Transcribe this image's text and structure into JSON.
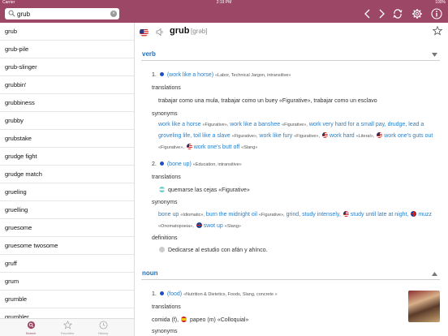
{
  "status_bar": {
    "carrier": "Carrier",
    "time": "2:19 PM",
    "battery": "100%"
  },
  "search": {
    "value": "grub"
  },
  "icons": {
    "search": "magnifier-icon",
    "clear": "clear-icon",
    "back": "chevron-left-icon",
    "forward": "chevron-right-icon",
    "refresh": "refresh-icon",
    "settings": "gear-icon",
    "info": "info-icon"
  },
  "word_list": [
    "grub",
    "grub-pile",
    "grub-slinger",
    "grubbin'",
    "grubbiness",
    "grubby",
    "grubstake",
    "grudge fight",
    "grudge match",
    "grueling",
    "gruelling",
    "gruesome",
    "gruesome twosome",
    "gruff",
    "grum",
    "grumble",
    "grumbler"
  ],
  "tabs": [
    {
      "label": "Search",
      "icon": "search-tab-icon"
    },
    {
      "label": "Favorites",
      "icon": "star-icon"
    },
    {
      "label": "History",
      "icon": "clock-icon"
    }
  ],
  "entry": {
    "headword": "grub",
    "ipa": "[grəb]",
    "sections": {
      "verb": "verb",
      "noun": "noun"
    },
    "labels": {
      "translations": "translations",
      "synonyms": "synonyms",
      "definitions": "definitions"
    },
    "sense1": {
      "num": "1.",
      "gloss": "(work like a horse)",
      "tags": "«Labor, Technical Jargon, intransitive»",
      "translation": "trabajar como una mula, trabajar como un buey «Figurative», trabajar como un esclavo",
      "syn": [
        {
          "w": "work like a horse",
          "t": "«Figurative»,"
        },
        {
          "w": "work like a banshee",
          "t": "«Figurative»,"
        },
        {
          "w": "work very hard for a small pay,",
          "t": ""
        },
        {
          "w": "drudge, lead a groveling life, toil like a slave",
          "t": "«Figurative»,"
        },
        {
          "w": "work like fury",
          "t": "«Figurative»,"
        },
        {
          "w": "work hard",
          "t": "«Literal»,"
        },
        {
          "w": "work one's guts out",
          "t": "«Figurative»,"
        },
        {
          "w": "work one's butt off",
          "t": "«Slang»"
        }
      ]
    },
    "sense2": {
      "num": "2.",
      "gloss": "(bone up)",
      "tags": "«Education, intransitive»",
      "translation": "quemarse las cejas «Figurative»",
      "syn": [
        {
          "w": "bone up",
          "t": "«Idiomatic»,"
        },
        {
          "w": "burn the midnight oil",
          "t": "«Figurative»,"
        },
        {
          "w": "grind, study intensely,",
          "t": ""
        },
        {
          "w": "study until late at night,",
          "t": ""
        },
        {
          "w": "muzz",
          "t": "«Onomatopoeia»,"
        },
        {
          "w": "swot up",
          "t": "«Slang»"
        }
      ],
      "definition": "Dedicarse al estudio con afán y ahínco."
    },
    "noun1": {
      "num": "1.",
      "gloss": "(food)",
      "tags": "«Nutrition & Dietetics, Foods, Slang, concrete »",
      "translation_a": "comida (f),",
      "translation_b": "papeo (m) «Colloquial»"
    },
    "photo_caption": "food-photo"
  },
  "colors": {
    "accent": "#9c4766",
    "link": "#2a7fc8",
    "section": "#2a6fb0"
  }
}
